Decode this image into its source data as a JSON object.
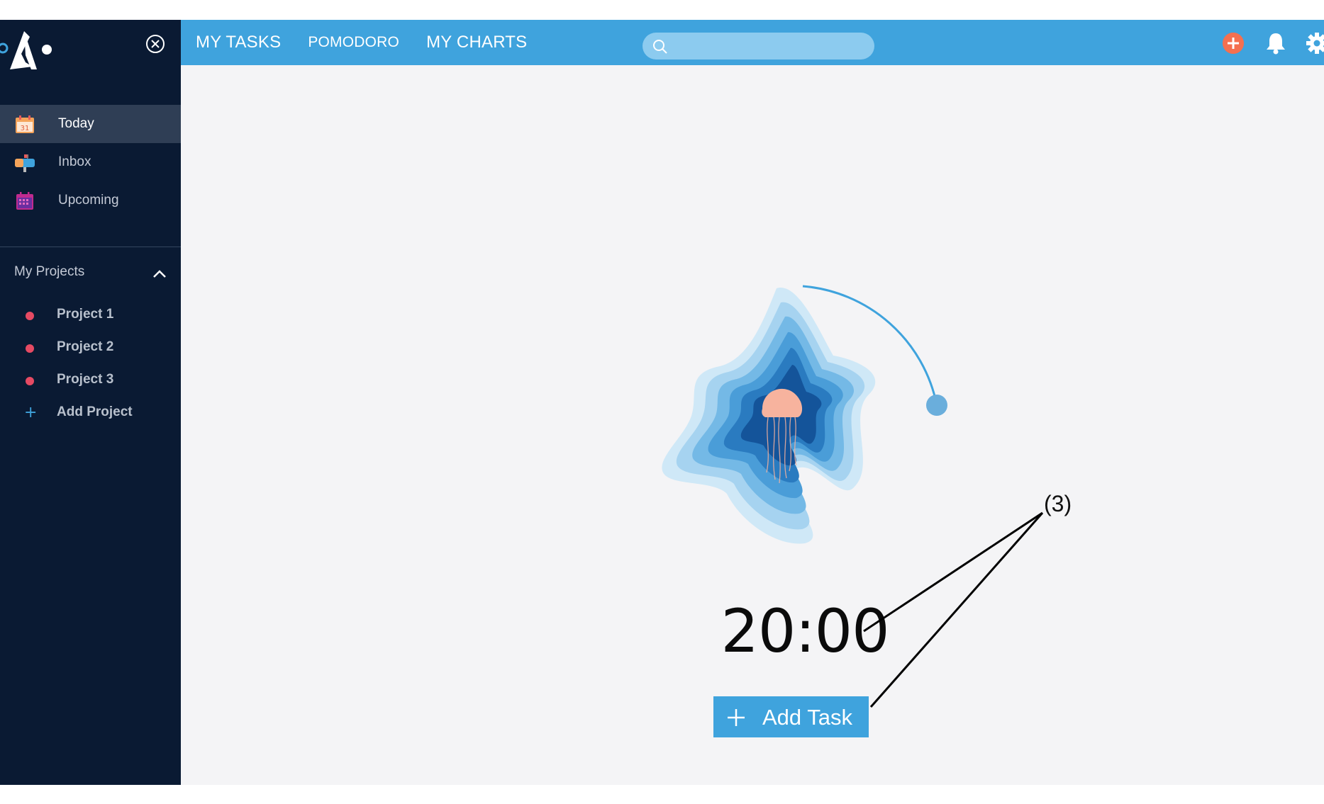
{
  "sidebar": {
    "close_icon": "close-circle-icon",
    "nav": [
      {
        "label": "Today",
        "icon": "calendar-31-icon",
        "active": true,
        "icon_text": "31"
      },
      {
        "label": "Inbox",
        "icon": "mailbox-icon",
        "active": false
      },
      {
        "label": "Upcoming",
        "icon": "calendar-grid-icon",
        "active": false
      }
    ],
    "projects_title": "My Projects",
    "projects": [
      {
        "label": "Project 1",
        "dot_color": "#e64a63"
      },
      {
        "label": "Project 2",
        "dot_color": "#e64a63"
      },
      {
        "label": "Project 3",
        "dot_color": "#e64a63"
      }
    ],
    "add_project_label": "Add Project"
  },
  "topbar": {
    "tabs": [
      "MY TASKS",
      "POMODORO",
      "MY CHARTS"
    ],
    "search_placeholder": "",
    "icons": [
      "add-circle-icon",
      "bell-icon",
      "gear-icon"
    ]
  },
  "pomodoro": {
    "time": "20:00",
    "add_task_label": "Add Task",
    "progress_color": "#3fa3dd"
  },
  "annotation": {
    "label": "(3)"
  },
  "colors": {
    "sidebar_bg": "#0a1a33",
    "accent": "#3fa3dd",
    "project_dot": "#e64a63",
    "main_bg": "#f4f4f6"
  }
}
